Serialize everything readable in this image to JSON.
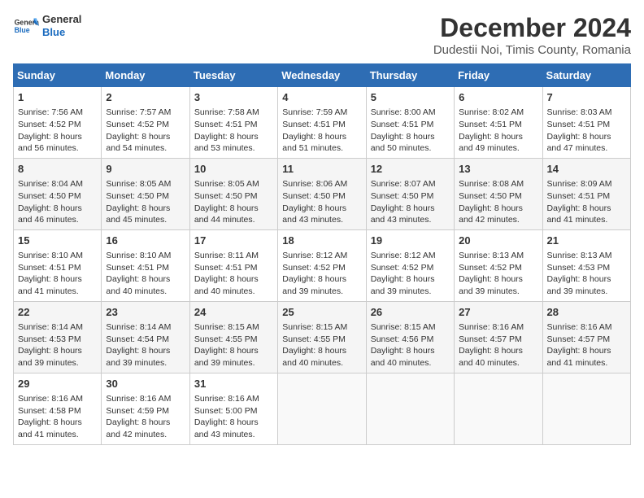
{
  "header": {
    "logo_general": "General",
    "logo_blue": "Blue",
    "main_title": "December 2024",
    "subtitle": "Dudestii Noi, Timis County, Romania"
  },
  "calendar": {
    "columns": [
      "Sunday",
      "Monday",
      "Tuesday",
      "Wednesday",
      "Thursday",
      "Friday",
      "Saturday"
    ],
    "rows": [
      [
        {
          "day": "1",
          "info": "Sunrise: 7:56 AM\nSunset: 4:52 PM\nDaylight: 8 hours\nand 56 minutes."
        },
        {
          "day": "2",
          "info": "Sunrise: 7:57 AM\nSunset: 4:52 PM\nDaylight: 8 hours\nand 54 minutes."
        },
        {
          "day": "3",
          "info": "Sunrise: 7:58 AM\nSunset: 4:51 PM\nDaylight: 8 hours\nand 53 minutes."
        },
        {
          "day": "4",
          "info": "Sunrise: 7:59 AM\nSunset: 4:51 PM\nDaylight: 8 hours\nand 51 minutes."
        },
        {
          "day": "5",
          "info": "Sunrise: 8:00 AM\nSunset: 4:51 PM\nDaylight: 8 hours\nand 50 minutes."
        },
        {
          "day": "6",
          "info": "Sunrise: 8:02 AM\nSunset: 4:51 PM\nDaylight: 8 hours\nand 49 minutes."
        },
        {
          "day": "7",
          "info": "Sunrise: 8:03 AM\nSunset: 4:51 PM\nDaylight: 8 hours\nand 47 minutes."
        }
      ],
      [
        {
          "day": "8",
          "info": "Sunrise: 8:04 AM\nSunset: 4:50 PM\nDaylight: 8 hours\nand 46 minutes."
        },
        {
          "day": "9",
          "info": "Sunrise: 8:05 AM\nSunset: 4:50 PM\nDaylight: 8 hours\nand 45 minutes."
        },
        {
          "day": "10",
          "info": "Sunrise: 8:05 AM\nSunset: 4:50 PM\nDaylight: 8 hours\nand 44 minutes."
        },
        {
          "day": "11",
          "info": "Sunrise: 8:06 AM\nSunset: 4:50 PM\nDaylight: 8 hours\nand 43 minutes."
        },
        {
          "day": "12",
          "info": "Sunrise: 8:07 AM\nSunset: 4:50 PM\nDaylight: 8 hours\nand 43 minutes."
        },
        {
          "day": "13",
          "info": "Sunrise: 8:08 AM\nSunset: 4:50 PM\nDaylight: 8 hours\nand 42 minutes."
        },
        {
          "day": "14",
          "info": "Sunrise: 8:09 AM\nSunset: 4:51 PM\nDaylight: 8 hours\nand 41 minutes."
        }
      ],
      [
        {
          "day": "15",
          "info": "Sunrise: 8:10 AM\nSunset: 4:51 PM\nDaylight: 8 hours\nand 41 minutes."
        },
        {
          "day": "16",
          "info": "Sunrise: 8:10 AM\nSunset: 4:51 PM\nDaylight: 8 hours\nand 40 minutes."
        },
        {
          "day": "17",
          "info": "Sunrise: 8:11 AM\nSunset: 4:51 PM\nDaylight: 8 hours\nand 40 minutes."
        },
        {
          "day": "18",
          "info": "Sunrise: 8:12 AM\nSunset: 4:52 PM\nDaylight: 8 hours\nand 39 minutes."
        },
        {
          "day": "19",
          "info": "Sunrise: 8:12 AM\nSunset: 4:52 PM\nDaylight: 8 hours\nand 39 minutes."
        },
        {
          "day": "20",
          "info": "Sunrise: 8:13 AM\nSunset: 4:52 PM\nDaylight: 8 hours\nand 39 minutes."
        },
        {
          "day": "21",
          "info": "Sunrise: 8:13 AM\nSunset: 4:53 PM\nDaylight: 8 hours\nand 39 minutes."
        }
      ],
      [
        {
          "day": "22",
          "info": "Sunrise: 8:14 AM\nSunset: 4:53 PM\nDaylight: 8 hours\nand 39 minutes."
        },
        {
          "day": "23",
          "info": "Sunrise: 8:14 AM\nSunset: 4:54 PM\nDaylight: 8 hours\nand 39 minutes."
        },
        {
          "day": "24",
          "info": "Sunrise: 8:15 AM\nSunset: 4:55 PM\nDaylight: 8 hours\nand 39 minutes."
        },
        {
          "day": "25",
          "info": "Sunrise: 8:15 AM\nSunset: 4:55 PM\nDaylight: 8 hours\nand 40 minutes."
        },
        {
          "day": "26",
          "info": "Sunrise: 8:15 AM\nSunset: 4:56 PM\nDaylight: 8 hours\nand 40 minutes."
        },
        {
          "day": "27",
          "info": "Sunrise: 8:16 AM\nSunset: 4:57 PM\nDaylight: 8 hours\nand 40 minutes."
        },
        {
          "day": "28",
          "info": "Sunrise: 8:16 AM\nSunset: 4:57 PM\nDaylight: 8 hours\nand 41 minutes."
        }
      ],
      [
        {
          "day": "29",
          "info": "Sunrise: 8:16 AM\nSunset: 4:58 PM\nDaylight: 8 hours\nand 41 minutes."
        },
        {
          "day": "30",
          "info": "Sunrise: 8:16 AM\nSunset: 4:59 PM\nDaylight: 8 hours\nand 42 minutes."
        },
        {
          "day": "31",
          "info": "Sunrise: 8:16 AM\nSunset: 5:00 PM\nDaylight: 8 hours\nand 43 minutes."
        },
        {
          "day": "",
          "info": ""
        },
        {
          "day": "",
          "info": ""
        },
        {
          "day": "",
          "info": ""
        },
        {
          "day": "",
          "info": ""
        }
      ]
    ]
  }
}
